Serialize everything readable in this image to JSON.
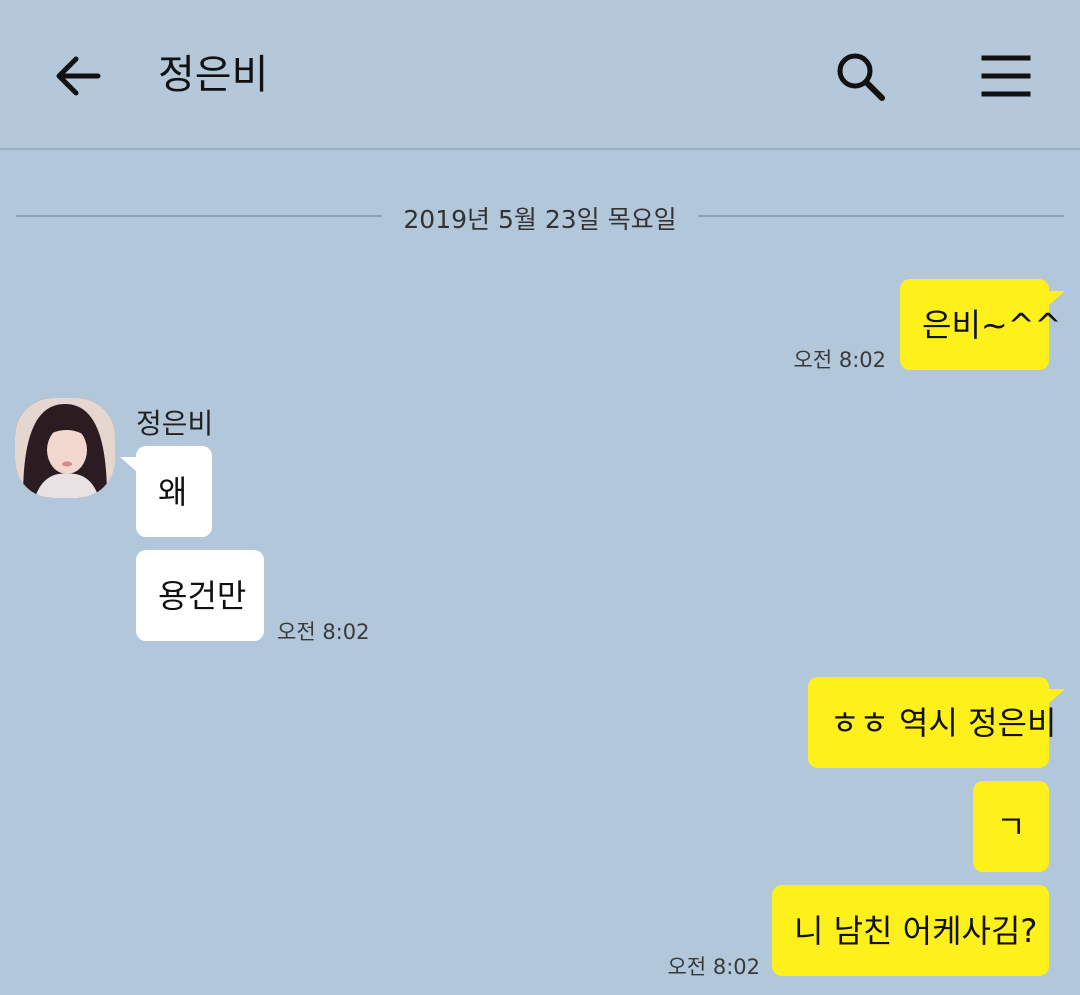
{
  "header": {
    "title": "정은비"
  },
  "date_separator": "2019년 5월 23일 목요일",
  "messages": {
    "m1": {
      "text": "은비~^^",
      "time": "오전 8:02"
    },
    "sender_name": "정은비",
    "r1": {
      "text": "왜"
    },
    "r2": {
      "text": "용건만",
      "time": "오전 8:02"
    },
    "m2": {
      "text": "ㅎㅎ 역시 정은비"
    },
    "m3": {
      "text": "ㄱ"
    },
    "m4": {
      "text": "니 남친 어케사김?",
      "time": "오전 8:02"
    }
  },
  "colors": {
    "background": "#b2c7d9",
    "my_bubble": "#fef01b",
    "their_bubble": "#ffffff"
  },
  "icons": {
    "back": "arrow-left-icon",
    "search": "search-icon",
    "menu": "hamburger-menu-icon"
  }
}
